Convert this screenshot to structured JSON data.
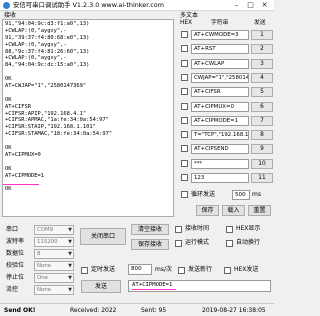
{
  "window": {
    "title": "安信可串口调试助手 V1.2.3.0    www.ai-thinker.com",
    "minimize": "–",
    "maximize": "□",
    "close": "✕"
  },
  "receive": {
    "label": "接收",
    "lines": [
      "91,\"94:04:9c:d3:f1:a0\",13)",
      "+CWLAP:(0,\"aygxy\",-",
      "91,\"39:37:f4:80:68:e0\",13)",
      "+CWLAP:(0,\"aygxy\",-",
      "88,\"9c:37:f4:81:26:60\",13)",
      "+CWLAP:(0,\"aygxy\",-",
      "84,\"94:04:9c:dc:15:a0\",13)",
      "",
      "OK",
      "AT+CWJAP=\"1\",\"2580147369\"",
      "",
      "OK",
      "AT+CIFSR",
      "+CIFSR:APIP,\"192.168.4.1\"",
      "+CIFSR:APMAC,\"1a:fe:34:0a:54:97\"",
      "+CIFSR:STAIP,\"192.168.1.101\"",
      "+CIFSR:STAMAC,\"18:fe:34:0a:54:97\"",
      "",
      "OK",
      "AT+CIPMUX=0",
      "",
      "OK",
      "AT+CIPMODE=1",
      "",
      "OK"
    ]
  },
  "multi_text": {
    "label": "多文本",
    "header_hex": "HEX",
    "header_string": "字符串",
    "header_send": "发送",
    "rows": [
      {
        "text": "AT+CWMODE=3",
        "num": "1"
      },
      {
        "text": "AT+RST",
        "num": "2"
      },
      {
        "text": "AT+CWLAP",
        "num": "3"
      },
      {
        "text": "CWJAP=\"1\",\"2580147369\"",
        "num": "4"
      },
      {
        "text": "AT+CIFSR",
        "num": "5"
      },
      {
        "text": "AT+CIPMUX=0",
        "num": "6"
      },
      {
        "text": "AT+CIPMODE=1",
        "num": "7"
      },
      {
        "text": "T=\"TCP\",\"192.168.1.101\",8",
        "num": "8"
      },
      {
        "text": "AT+CIPSEND",
        "num": "9"
      },
      {
        "text": "***",
        "num": "10"
      },
      {
        "text": "123",
        "num": "11"
      }
    ],
    "loop_label": "循环发送",
    "loop_interval": "500",
    "ms_unit": "ms",
    "save_button": "保存",
    "load_button": "载入",
    "reset_button": "重置"
  },
  "settings": {
    "port_label": "串口",
    "port_value": "COM9",
    "baud_label": "波特率",
    "baud_value": "115200",
    "databits_label": "数据位",
    "databits_value": "8",
    "parity_label": "校验位",
    "parity_value": "None",
    "stopbits_label": "停止位",
    "stopbits_value": "One",
    "flow_label": "流控",
    "flow_value": "None",
    "close_port_button": "关闭串口",
    "clear_receive_button": "清空接收",
    "save_receive_button": "保存接收",
    "receive_time_label": "接收时间",
    "hex_display_label": "HEX显示",
    "run_mode_label": "运行模式",
    "auto_newline_label": "自动换行"
  },
  "send": {
    "timed_send_label": "定时发送",
    "interval_value": "800",
    "interval_unit": "ms/次",
    "send_newline_label": "发送新行",
    "hex_send_label": "HEX发送",
    "send_button": "发送",
    "input_value": "AT+CIPMODE=1"
  },
  "status": {
    "send_ok": "Send OK!",
    "received": "Received: 2022",
    "sent": "Sent: 95",
    "timestamp": "2019-08-27 16:38:05"
  },
  "colors": {
    "highlight": "#ff33cc",
    "button_face": "#e1e1e1",
    "field_border": "#9a9a9a"
  }
}
